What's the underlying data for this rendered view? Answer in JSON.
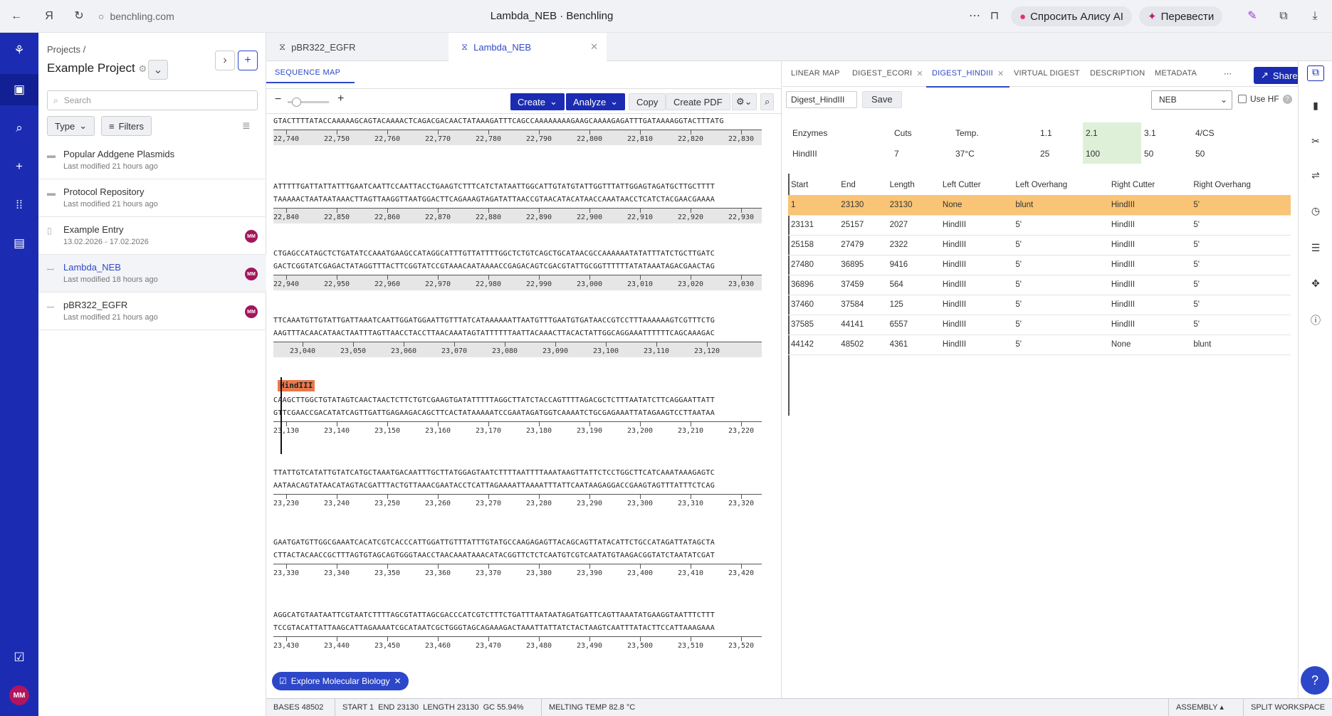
{
  "browser": {
    "url": "benchling.com",
    "title": "Lambda_NEB · Benchling",
    "alice": "Спросить Алису AI",
    "translate": "Перевести"
  },
  "nav": {
    "user": "MM"
  },
  "project": {
    "crumb": "Projects /",
    "title": "Example Project",
    "search_placeholder": "Search",
    "type_filter": "Type",
    "filters": "Filters",
    "items": [
      {
        "name": "Popular Addgene Plasmids",
        "sub": "Last modified 21 hours ago",
        "icon": "folder-icon",
        "avatar": ""
      },
      {
        "name": "Protocol Repository",
        "sub": "Last modified 21 hours ago",
        "icon": "folder-icon",
        "avatar": ""
      },
      {
        "name": "Example Entry",
        "sub": "13.02.2026 - 17.02.2026",
        "icon": "document-icon",
        "avatar": "MM"
      },
      {
        "name": "Lambda_NEB",
        "sub": "Last modified 18 hours ago",
        "icon": "dna-icon",
        "avatar": "MM"
      },
      {
        "name": "pBR322_EGFR",
        "sub": "Last modified 21 hours ago",
        "icon": "dna-icon",
        "avatar": "MM"
      }
    ]
  },
  "tabs": [
    {
      "label": "pBR322_EGFR"
    },
    {
      "label": "Lambda_NEB"
    }
  ],
  "seq": {
    "header": "SEQUENCE MAP",
    "create": "Create",
    "analyze": "Analyze",
    "copy": "Copy",
    "pdf": "Create PDF",
    "explore": "Explore Molecular Biology",
    "enzyme": "HindIII",
    "blocks": [
      {
        "lines": [
          "GTACTTTTATACCAAAAAGCAGTACAAAACTCAGACGACAACTATAAAGATTTCAGCCAAAAAAAAGAAGCAAAAGAGATTTGATAAAAGGTACTTTATG"
        ],
        "ticks": [
          "22,740",
          "22,750",
          "22,760",
          "22,770",
          "22,780",
          "22,790",
          "22,800",
          "22,810",
          "22,820",
          "22,830"
        ]
      },
      {
        "lines": [
          "ATTTTTGATTATTATTTGAATCAATTCCAATTACCTGAAGTCTTTCATCTATAATTGGCATTGTATGTATTGGTTTATTGGAGTAGATGCTTGCTTTT",
          "TAAAAACTAATAATAAACTTAGTTAAGGTTAATGGACTTCAGAAAGTAGATATTAACCGTAACATACATAACCAAATAACCTCATCTACGAACGAAAA"
        ],
        "ticks": [
          "22,840",
          "22,850",
          "22,860",
          "22,870",
          "22,880",
          "22,890",
          "22,900",
          "22,910",
          "22,920",
          "22,930"
        ]
      },
      {
        "lines": [
          "CTGAGCCATAGCTCTGATATCCAAATGAAGCCATAGGCATTTGTTATTTTGGCTCTGTCAGCTGCATAACGCCAAAAAATATATTTATCTGCTTGATC",
          "GACTCGGTATCGAGACTATAGGTTTACTTCGGTATCCGTAAACAATAAAACCGAGACAGTCGACGTATTGCGGTTTTTTATATAAATAGACGAACTAG"
        ],
        "ticks": [
          "22,940",
          "22,950",
          "22,960",
          "22,970",
          "22,980",
          "22,990",
          "23,000",
          "23,010",
          "23,020",
          "23,030"
        ]
      },
      {
        "lines": [
          "TTCAAATGTTGTATTGATTAAATCAATTGGATGGAATTGTTTATCATAAAAAATTAATGTTTGAATGTGATAACCGTCCTTTAAAAAAGTCGTTTCTG",
          "AAGTTTACAACATAACTAATTTAGTTAACCTACCTTAACAAATAGTATTTTTTAATTACAAACTTACACTATTGGCAGGAAATTTTTTCAGCAAAGAC"
        ],
        "ticks": [
          "23,040",
          "23,050",
          "23,060",
          "23,070",
          "23,080",
          "23,090",
          "23,100",
          "23,110",
          "23,120"
        ]
      },
      {
        "lines": [
          "CAAGCTTGGCTGTATAGTCAACTAACTCTTCTGTCGAAGTGATATTTTTAGGCTTATCTACCAGTTTTAGACGCTCTTTAATATCTTCAGGAATTATT",
          "GTTCGAACCGACATATCAGTTGATTGAGAAGACAGCTTCACTATAAAAATCCGAATAGATGGTCAAAATCTGCGAGAAATTATAGAAGTCCTTAATAA"
        ],
        "ticks": [
          "23,130",
          "23,140",
          "23,150",
          "23,160",
          "23,170",
          "23,180",
          "23,190",
          "23,200",
          "23,210",
          "23,220"
        ]
      },
      {
        "lines": [
          "TTATTGTCATATTGTATCATGCTAAATGACAATTTGCTTATGGAGTAATCTTTTAATTTTAAATAAGTTATTCTCCTGGCTTCATCAAATAAAGAGTC",
          "AATAACAGTATAACATAGTACGATTTACTGTTAAACGAATACCTCATTAGAAAATTAAAATTTATTCAATAAGAGGACCGAAGTAGTTTATTTCTCAG"
        ],
        "ticks": [
          "23,230",
          "23,240",
          "23,250",
          "23,260",
          "23,270",
          "23,280",
          "23,290",
          "23,300",
          "23,310",
          "23,320"
        ]
      },
      {
        "lines": [
          "GAATGATGTTGGCGAAATCACATCGTCACCCATTGGATTGTTTATTTGTATGCCAAGAGAGTTACAGCAGTTATACATTCTGCCATAGATTATAGCTA",
          "CTTACTACAACCGCTTTAGTGTAGCAGTGGGTAACCTAACAAATAAACATACGGTTCTCTCAATGTCGTCAATATGTAAGACGGTATCTAATATCGAT"
        ],
        "ticks": [
          "23,330",
          "23,340",
          "23,350",
          "23,360",
          "23,370",
          "23,380",
          "23,390",
          "23,400",
          "23,410",
          "23,420"
        ]
      },
      {
        "lines": [
          "AGGCATGTAATAATTCGTAATCTTTTAGCGTATTAGCGACCCATCGTCTTTCTGATTTAATAATAGATGATTCAGTTAAATATGAAGGTAATTTCTTT",
          "TCCGTACATTATTAAGCATTAGAAAATCGCATAATCGCTGGGTAGCAGAAAGACTAAATTATTATCTACTAAGTCAATTTATACTTCCATTAAAGAAA"
        ],
        "ticks": [
          "23,430",
          "23,440",
          "23,450",
          "23,460",
          "23,470",
          "23,480",
          "23,490",
          "23,500",
          "23,510",
          "23,520"
        ]
      }
    ]
  },
  "right": {
    "tabs": [
      "LINEAR MAP",
      "DIGEST_ECORI",
      "DIGEST_HINDIII",
      "VIRTUAL DIGEST",
      "DESCRIPTION",
      "METADATA"
    ],
    "share": "Share",
    "digest_name": "Digest_HindIII",
    "save": "Save",
    "vendor": "NEB",
    "use_hf": "Use HF",
    "enz_header": [
      "Enzymes",
      "Cuts",
      "Temp.",
      "1.1",
      "2.1",
      "3.1",
      "4/CS"
    ],
    "enz_row": [
      "HindIII",
      "7",
      "37°C",
      "25",
      "100",
      "50",
      "50"
    ],
    "frag_header": [
      "Start",
      "End",
      "Length",
      "Left Cutter",
      "Left Overhang",
      "Right Cutter",
      "Right Overhang"
    ],
    "fragments": [
      [
        "1",
        "23130",
        "23130",
        "None",
        "blunt",
        "HindIII",
        "5'"
      ],
      [
        "23131",
        "25157",
        "2027",
        "HindIII",
        "5'",
        "HindIII",
        "5'"
      ],
      [
        "25158",
        "27479",
        "2322",
        "HindIII",
        "5'",
        "HindIII",
        "5'"
      ],
      [
        "27480",
        "36895",
        "9416",
        "HindIII",
        "5'",
        "HindIII",
        "5'"
      ],
      [
        "36896",
        "37459",
        "564",
        "HindIII",
        "5'",
        "HindIII",
        "5'"
      ],
      [
        "37460",
        "37584",
        "125",
        "HindIII",
        "5'",
        "HindIII",
        "5'"
      ],
      [
        "37585",
        "44141",
        "6557",
        "HindIII",
        "5'",
        "HindIII",
        "5'"
      ],
      [
        "44142",
        "48502",
        "4361",
        "HindIII",
        "5'",
        "None",
        "blunt"
      ]
    ]
  },
  "status": {
    "bases_l": "BASES",
    "bases": "48502",
    "start_l": "START",
    "start": "1",
    "end_l": "END",
    "end": "23130",
    "length_l": "LENGTH",
    "length": "23130",
    "gc_l": "GC",
    "gc": "55.94%",
    "tm_l": "MELTING TEMP",
    "tm": "82.8 °C",
    "assembly": "ASSEMBLY",
    "split": "SPLIT WORKSPACE"
  },
  "help": "?"
}
